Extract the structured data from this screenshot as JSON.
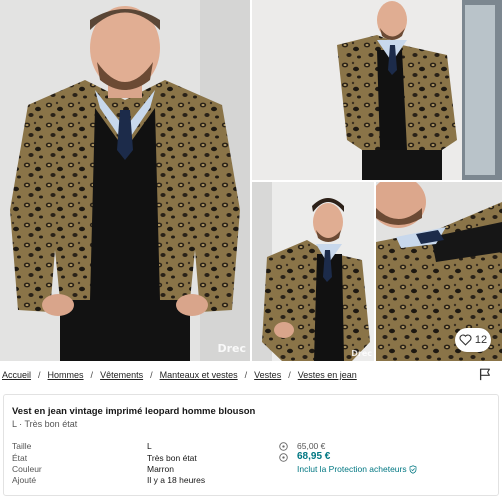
{
  "gallery": {
    "watermark": "Drec",
    "watermark_small": "Drec",
    "favorites_count": "12",
    "photos": [
      "front-view",
      "side-view",
      "full-body-view",
      "close-up-view"
    ]
  },
  "breadcrumb": {
    "items": [
      "Accueil",
      "Hommes",
      "Vêtements",
      "Manteaux et vestes",
      "Vestes",
      "Vestes en jean"
    ],
    "separator": "/"
  },
  "item": {
    "title": "Vest en jean vintage imprimé leopard homme blouson",
    "subtitle": "L · Très bon état",
    "details": [
      {
        "label": "Taille",
        "value": "L"
      },
      {
        "label": "État",
        "value": "Très bon état"
      },
      {
        "label": "Couleur",
        "value": "Marron"
      },
      {
        "label": "Ajouté",
        "value": "Il y a 18 heures"
      }
    ],
    "price_original": "65,00 €",
    "price_total": "68,95 €",
    "protection_label": "Inclut la Protection acheteurs"
  },
  "colors": {
    "accent": "#007782",
    "leopard_base": "#7a6540",
    "leopard_spot": "#1b1712"
  },
  "icons": {
    "favorite": "heart-icon",
    "report": "flag-icon",
    "info": "info-icon",
    "protection": "shield-icon"
  }
}
